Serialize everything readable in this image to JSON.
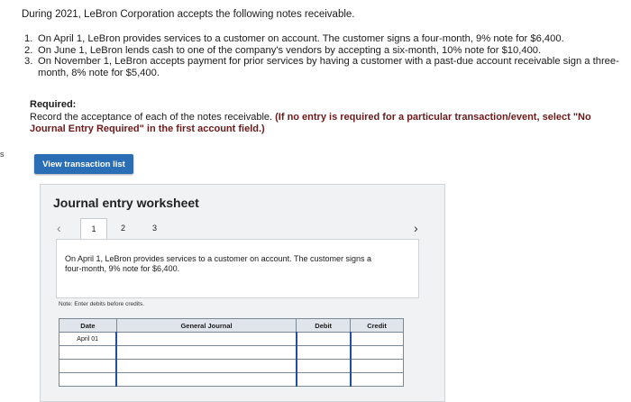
{
  "edge_mark": "s",
  "problem": {
    "intro": "During 2021, LeBron Corporation accepts the following notes receivable.",
    "items": [
      {
        "num": "1.",
        "text": "On April 1, LeBron provides services to a customer on account. The customer signs a four-month, 9% note for $6,400."
      },
      {
        "num": "2.",
        "text": "On June 1, LeBron lends cash to one of the company's vendors by accepting a six-month, 10% note for $10,400."
      },
      {
        "num": "3.",
        "text": "On November 1, LeBron accepts payment for prior services by having a customer with a past-due account receivable sign a three-month, 8% note for $5,400."
      }
    ]
  },
  "required": {
    "title": "Required:",
    "text": "Record the acceptance of each of the notes receivable.",
    "emphasis": "(If no entry is required for a particular transaction/event, select \"No Journal Entry Required\" in the first account field.)"
  },
  "view_button": "View transaction list",
  "worksheet": {
    "title": "Journal entry worksheet",
    "prev_icon": "‹",
    "next_icon": "›",
    "tabs": [
      "1",
      "2",
      "3"
    ],
    "description": "On April 1, LeBron provides services to a customer on account. The customer signs a four-month, 9% note for $6,400.",
    "note": "Note: Enter debits before credits.",
    "table": {
      "headers": [
        "Date",
        "General Journal",
        "Debit",
        "Credit"
      ],
      "rows": [
        [
          "April 01",
          "",
          "",
          ""
        ],
        [
          "",
          "",
          "",
          ""
        ],
        [
          "",
          "",
          "",
          ""
        ],
        [
          "",
          "",
          "",
          ""
        ]
      ]
    }
  }
}
